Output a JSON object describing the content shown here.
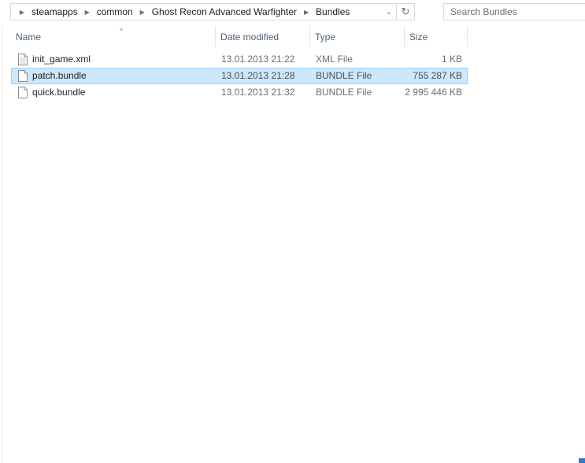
{
  "address_bar": {
    "breadcrumbs": [
      "steamapps",
      "common",
      "Ghost Recon Advanced Warfighter",
      "Bundles"
    ]
  },
  "search": {
    "placeholder": "Search Bundles"
  },
  "columns": {
    "name": "Name",
    "date_modified": "Date modified",
    "type": "Type",
    "size": "Size"
  },
  "files": [
    {
      "name": "init_game.xml",
      "date": "13.01.2013 21:22",
      "type": "XML File",
      "size": "1 KB",
      "selected": false
    },
    {
      "name": "patch.bundle",
      "date": "13.01.2013 21:28",
      "type": "BUNDLE File",
      "size": "755 287 KB",
      "selected": true
    },
    {
      "name": "quick.bundle",
      "date": "13.01.2013 21:32",
      "type": "BUNDLE File",
      "size": "2 995 446 KB",
      "selected": false
    }
  ]
}
